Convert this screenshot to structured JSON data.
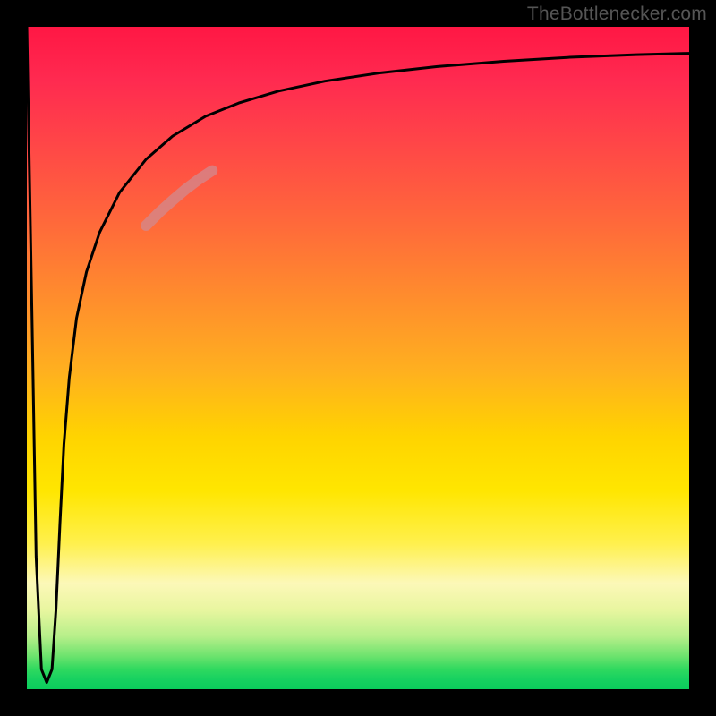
{
  "watermark": {
    "text": "TheBottlenecker.com"
  },
  "chart_data": {
    "type": "line",
    "title": "",
    "xlabel": "",
    "ylabel": "",
    "xlim": [
      0,
      100
    ],
    "ylim": [
      0,
      100
    ],
    "grid": false,
    "legend": false,
    "background": {
      "type": "vertical-gradient",
      "stops": [
        {
          "pos": 0.0,
          "color": "#ff1744"
        },
        {
          "pos": 0.3,
          "color": "#ff6a3a"
        },
        {
          "pos": 0.55,
          "color": "#ffc81a"
        },
        {
          "pos": 0.72,
          "color": "#ffe600"
        },
        {
          "pos": 0.86,
          "color": "#f4f6a6"
        },
        {
          "pos": 0.95,
          "color": "#6de36e"
        },
        {
          "pos": 1.0,
          "color": "#0bcd5c"
        }
      ]
    },
    "series": [
      {
        "name": "bottleneck-curve",
        "color": "#000000",
        "stroke_width": 3,
        "x": [
          0.0,
          0.8,
          1.4,
          2.2,
          3.0,
          3.8,
          4.4,
          5.0,
          5.6,
          6.4,
          7.5,
          9.0,
          11.0,
          14.0,
          18.0,
          22.0,
          27.0,
          32.0,
          38.0,
          45.0,
          53.0,
          62.0,
          72.0,
          82.0,
          92.0,
          100.0
        ],
        "y": [
          100.0,
          55.0,
          20.0,
          3.0,
          1.0,
          3.0,
          12.0,
          25.0,
          37.0,
          47.0,
          56.0,
          63.0,
          69.0,
          75.0,
          80.0,
          83.5,
          86.5,
          88.5,
          90.3,
          91.8,
          93.0,
          94.0,
          94.8,
          95.4,
          95.8,
          96.0
        ]
      },
      {
        "name": "highlight-segment",
        "color": "#d28a8f",
        "stroke_width": 12,
        "opacity": 0.75,
        "x": [
          18.0,
          20.0,
          22.0,
          24.0,
          26.0,
          28.0
        ],
        "y": [
          70.0,
          72.0,
          73.8,
          75.5,
          77.0,
          78.3
        ]
      }
    ]
  }
}
